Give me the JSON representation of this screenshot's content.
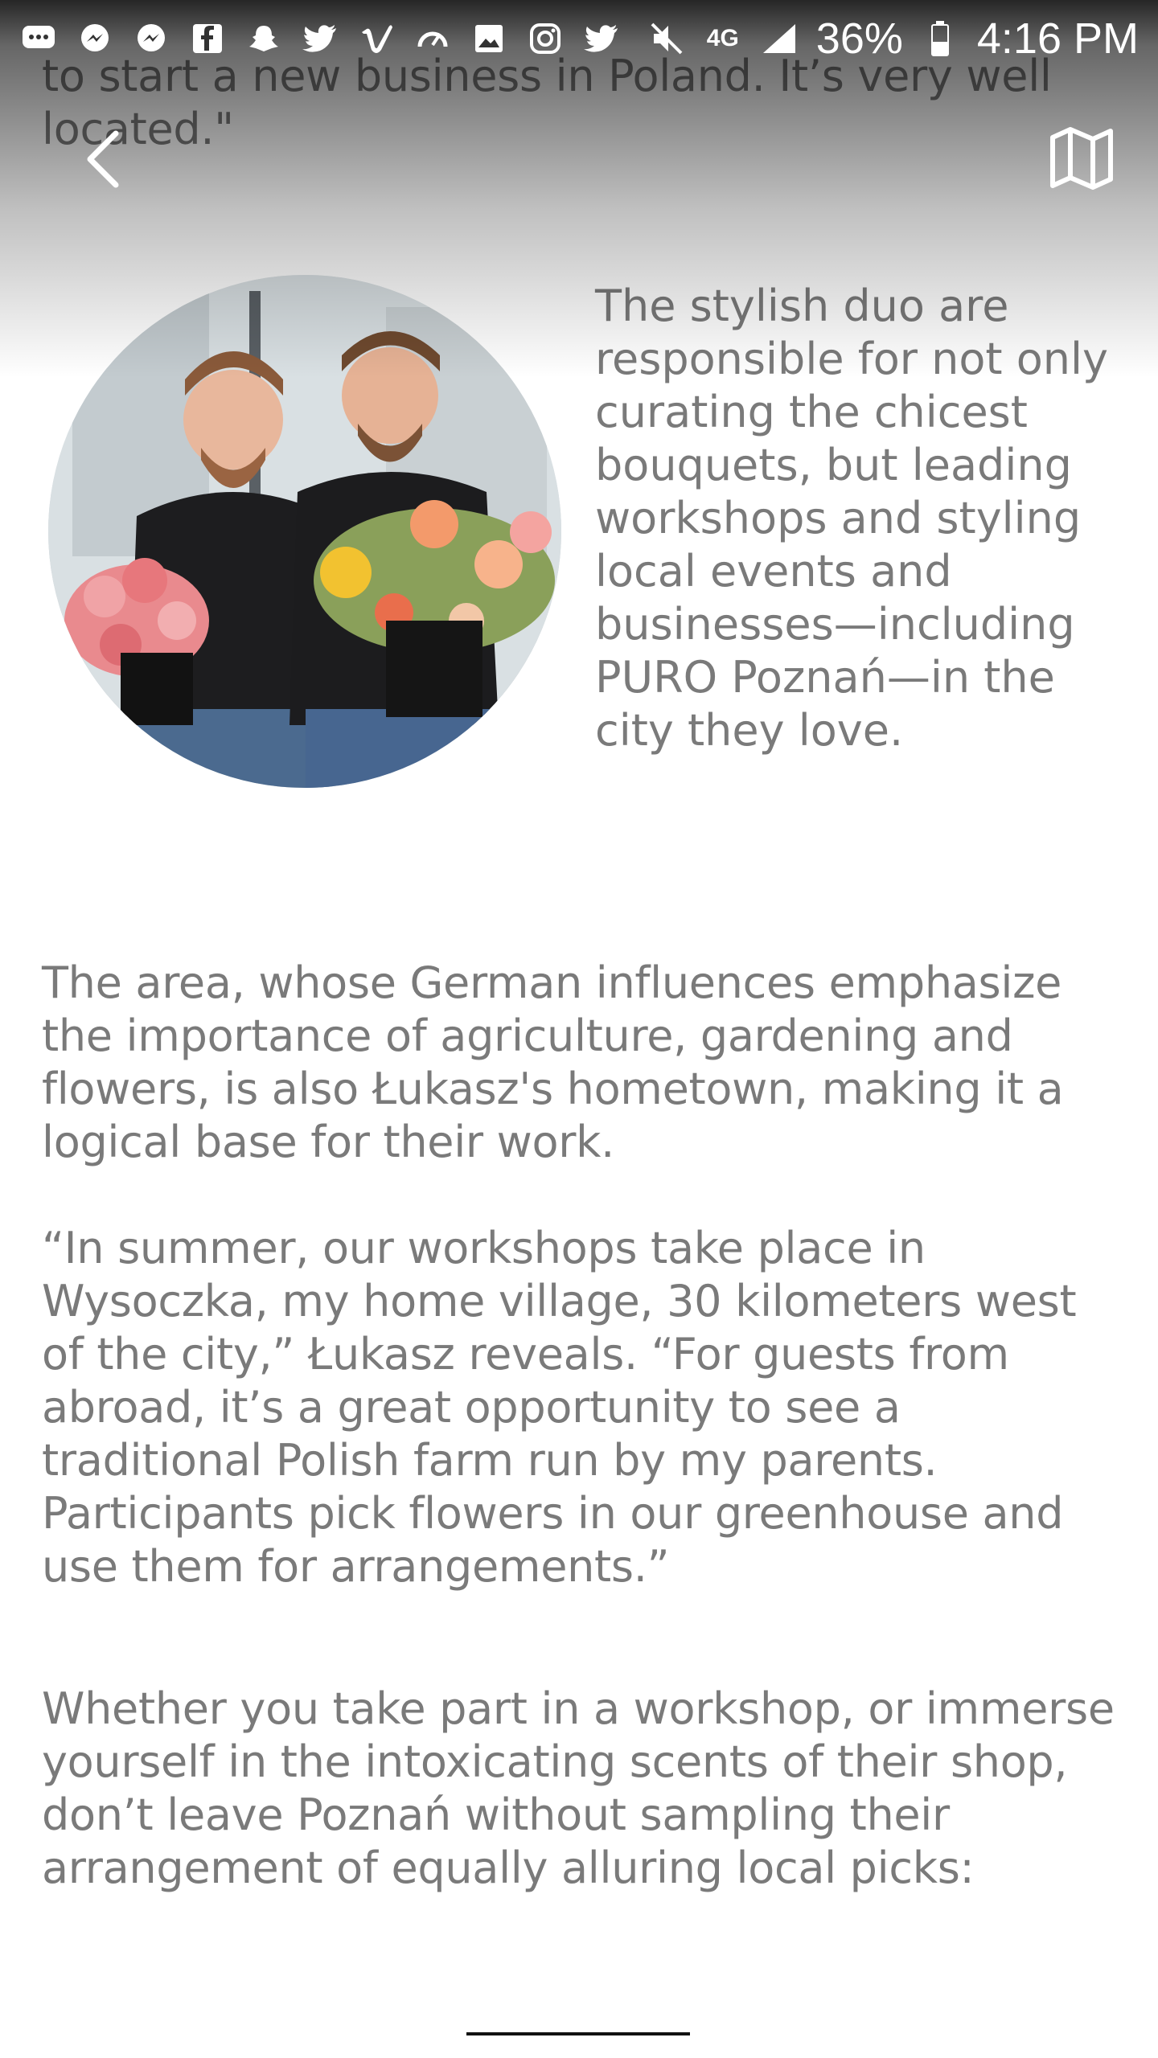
{
  "status_bar": {
    "battery": "36%",
    "time": "4:16 PM",
    "network": "4G",
    "icons_left": [
      "chat-icon",
      "messenger-icon",
      "messenger-icon",
      "facebook-icon",
      "snapchat-icon",
      "twitter-icon",
      "vimeo-icon",
      "speedometer-icon",
      "photo-icon",
      "instagram-icon",
      "twitter-icon"
    ],
    "icons_right": [
      "mute-icon",
      "lte-icon",
      "signal-icon",
      "battery-icon"
    ]
  },
  "nav": {
    "back_icon": "chevron-left-icon",
    "map_icon": "map-icon"
  },
  "article": {
    "intro_tail_line1": "to start a new business in Poland. It’s very well",
    "intro_tail_line2": "located.\"",
    "photo_side_text": "The stylish duo are responsible for not only curating the chicest bouquets, but leading workshops and styling local events and businesses—including PURO Poznań—in the city they love.",
    "para_area": "The area, whose German influences emphasize the importance of agriculture, gardening and flowers, is also Łukasz's hometown, making it a logical base for their work.",
    "para_quote": "“In summer, our workshops take place in Wysoczka, my home village, 30 kilometers west of the city,” Łukasz reveals. “For guests from abroad, it’s a great opportunity to see a traditional Polish farm run by my parents. Participants pick flowers in our greenhouse and use them for arrangements.”",
    "para_closing": "Whether you take part in a workshop, or immerse yourself in the intoxicating scents of their shop, don’t leave Poznań without sampling their arrangement of equally alluring local picks:"
  },
  "colors": {
    "text": "#7a7a7a",
    "overlay": "#000000",
    "divider": "#111111"
  }
}
